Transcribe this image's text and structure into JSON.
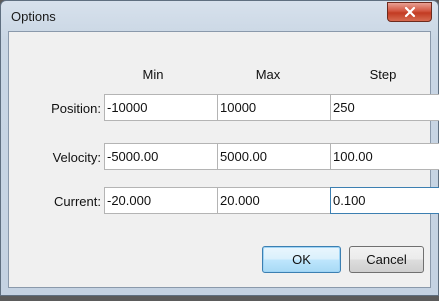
{
  "window": {
    "title": "Options",
    "close_glyph": "✕"
  },
  "columns": {
    "min": "Min",
    "max": "Max",
    "step": "Step"
  },
  "rows": [
    {
      "label": "Position:",
      "min": "-10000",
      "max": "10000",
      "step": "250"
    },
    {
      "label": "Velocity:",
      "min": "-5000.00",
      "max": "5000.00",
      "step": "100.00"
    },
    {
      "label": "Current:",
      "min": "-20.000",
      "max": "20.000",
      "step": "0.100"
    }
  ],
  "buttons": {
    "ok": "OK",
    "cancel": "Cancel"
  },
  "colors": {
    "accent": "#3c7fb1",
    "close": "#c23b22"
  }
}
